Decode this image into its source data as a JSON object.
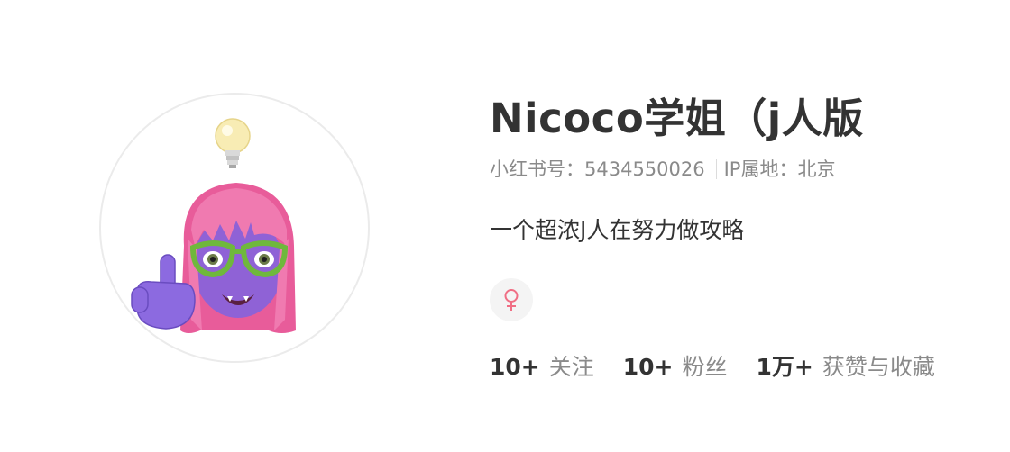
{
  "profile": {
    "nickname": "Nicoco学姐（j人版",
    "red_id_text": "小红书号：5434550026",
    "ip_text": "IP属地：北京",
    "description": "一个超浓J人在努力做攻略",
    "gender_icon": "female-icon",
    "gender_color": "#f06e84"
  },
  "stats": [
    {
      "num": "10+",
      "label": "关注"
    },
    {
      "num": "10+",
      "label": "粉丝"
    },
    {
      "num": "1万+",
      "label": "获赞与收藏"
    }
  ]
}
